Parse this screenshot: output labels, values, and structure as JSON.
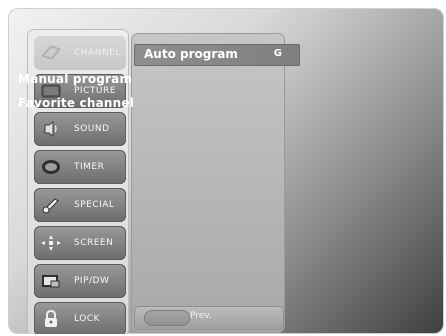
{
  "main_menu": {
    "items": [
      {
        "label": "CHANNEL",
        "icon": "channel-icon",
        "active": true
      },
      {
        "label": "PICTURE",
        "icon": "picture-icon",
        "active": false
      },
      {
        "label": "SOUND",
        "icon": "sound-icon",
        "active": false
      },
      {
        "label": "TIMER",
        "icon": "timer-icon",
        "active": false
      },
      {
        "label": "SPECIAL",
        "icon": "special-icon",
        "active": false
      },
      {
        "label": "SCREEN",
        "icon": "screen-icon",
        "active": false
      },
      {
        "label": "PIP/DW",
        "icon": "pip-dw-icon",
        "active": false
      },
      {
        "label": "LOCK",
        "icon": "lock-icon",
        "active": false
      }
    ]
  },
  "submenu": {
    "selected": {
      "label": "Auto program",
      "shortcut": "G"
    },
    "items": [
      {
        "label": "Manual program"
      },
      {
        "label": "Favorite channel"
      }
    ],
    "footer": {
      "prev_label": "Prev."
    }
  },
  "colors": {
    "panel_light": "#d9d9d9",
    "panel_dark": "#6c6c6c",
    "highlight": "#8a8a8a",
    "text": "#ffffff"
  }
}
